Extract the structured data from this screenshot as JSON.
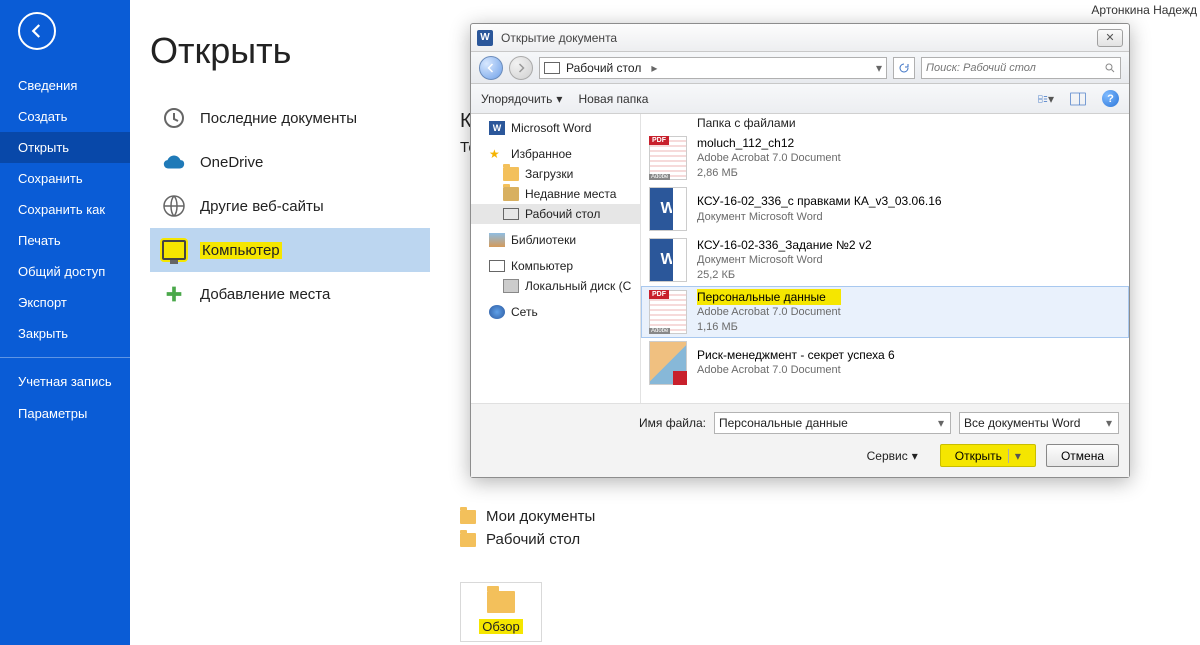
{
  "author": "Артонкина Надежд",
  "sidebar": {
    "items": [
      "Сведения",
      "Создать",
      "Открыть",
      "Сохранить",
      "Сохранить как",
      "Печать",
      "Общий доступ",
      "Экспорт",
      "Закрыть"
    ],
    "bottom": [
      "Учетная запись",
      "Параметры"
    ]
  },
  "main": {
    "title": "Открыть",
    "locations": [
      {
        "label": "Последние документы"
      },
      {
        "label": "OneDrive"
      },
      {
        "label": "Другие веб-сайты"
      },
      {
        "label": "Компьютер",
        "highlighted": true
      },
      {
        "label": "Добавление места"
      }
    ],
    "right_cut1": "Компьютер",
    "right_cut2": "Текущая папка",
    "folders": [
      "Мои документы",
      "Рабочий стол"
    ],
    "browse": "Обзор"
  },
  "dialog": {
    "title": "Открытие документа",
    "crumb_location": "Рабочий стол",
    "search_placeholder": "Поиск: Рабочий стол",
    "toolbar": {
      "organize": "Упорядочить",
      "newfolder": "Новая папка"
    },
    "tree": {
      "word": "Microsoft Word",
      "fav": "Избранное",
      "fav_children": [
        "Загрузки",
        "Недавние места",
        "Рабочий стол"
      ],
      "lib": "Библиотеки",
      "comp": "Компьютер",
      "comp_children": [
        "Локальный диск (C"
      ],
      "net": "Сеть"
    },
    "files": {
      "toprow": "Папка с файлами",
      "items": [
        {
          "kind": "pdf",
          "name": "moluch_112_ch12",
          "type": "Adobe Acrobat 7.0 Document",
          "size": "2,86 МБ"
        },
        {
          "kind": "word",
          "name": "КСУ-16-02_336_с правками КА_v3_03.06.16",
          "type": "Документ Microsoft Word",
          "size": ""
        },
        {
          "kind": "word",
          "name": "КСУ-16-02-336_Задание №2 v2",
          "type": "Документ Microsoft Word",
          "size": "25,2 КБ"
        },
        {
          "kind": "pdf",
          "name": "Персональные данные",
          "type": "Adobe Acrobat 7.0 Document",
          "size": "1,16 МБ",
          "selected": true,
          "highlighted": true
        },
        {
          "kind": "img",
          "name": "Риск-менеджмент - секрет успеха 6",
          "type": "Adobe Acrobat 7.0 Document",
          "size": ""
        }
      ]
    },
    "footer": {
      "fname_label": "Имя файла:",
      "fname_value": "Персональные данные",
      "filter": "Все документы Word",
      "service": "Сервис",
      "open": "Открыть",
      "cancel": "Отмена"
    }
  }
}
